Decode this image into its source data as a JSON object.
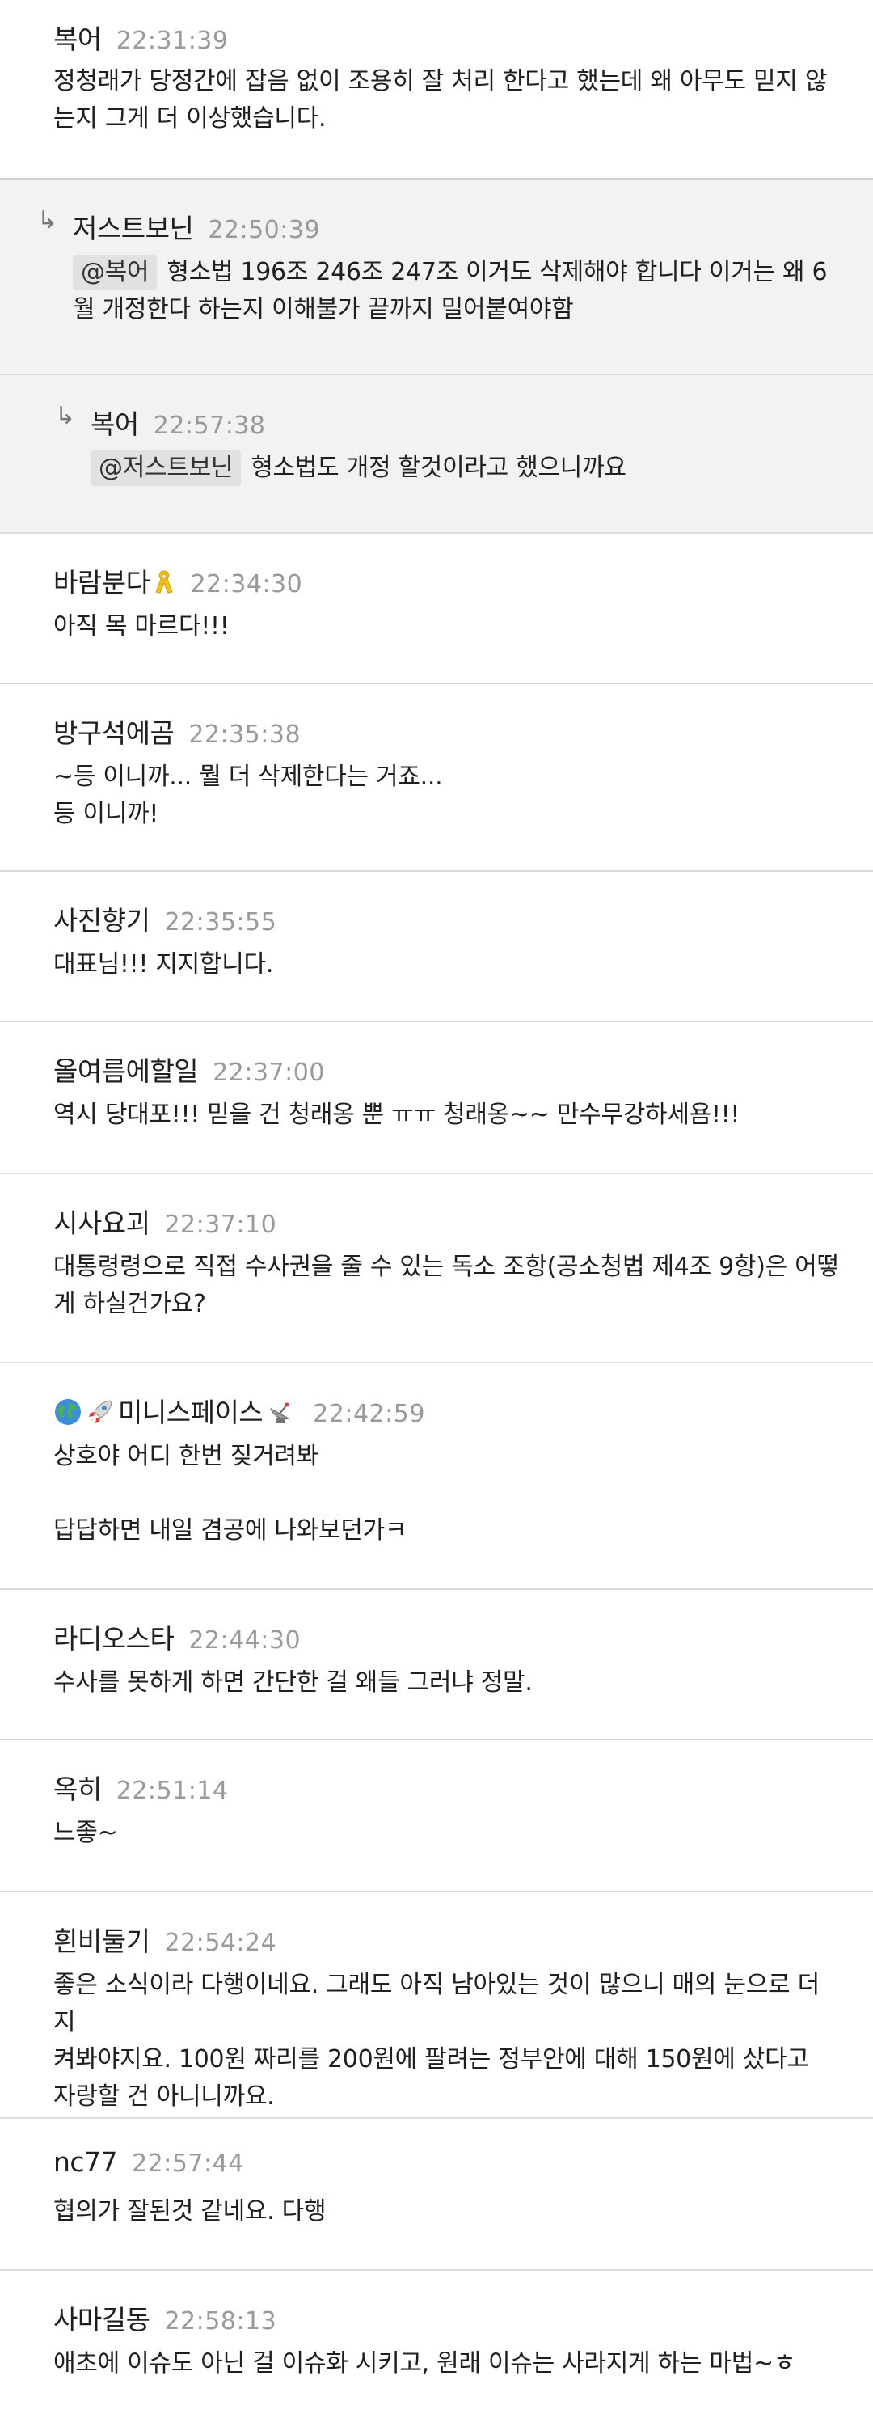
{
  "comments": [
    {
      "author": "복어",
      "time": "22:31:39",
      "lines": [
        "정청래가 당정간에 잡음 없이 조용히 잘 처리 한다고 했는데 왜 아무도 믿지 않",
        "는지 그게 더 이상했습니다."
      ]
    },
    {
      "author": "저스트보닌",
      "time": "22:50:39",
      "mention": "@복어",
      "lines": [
        "형소법 196조 246조 247조 이거도 삭제해야 합니다 이거는 왜 6",
        "월 개정한다 하는지 이해불가 끝까지 밀어붙여야함"
      ]
    },
    {
      "author": "복어",
      "time": "22:57:38",
      "mention": "@저스트보닌",
      "lines": [
        "형소법도 개정 할것이라고 했으니까요"
      ]
    },
    {
      "author": "바람분다",
      "time": "22:34:30",
      "lines": [
        "아직 목 마르다!!!"
      ]
    },
    {
      "author": "방구석에곰",
      "time": "22:35:38",
      "lines": [
        "~등 이니까... 뭘 더 삭제한다는 거죠...",
        "등 이니까!"
      ]
    },
    {
      "author": "사진향기",
      "time": "22:35:55",
      "lines": [
        "대표님!!! 지지합니다."
      ]
    },
    {
      "author": "올여름에할일",
      "time": "22:37:00",
      "lines": [
        "역시 당대포!!! 믿을 건 청래옹 뿐 ㅠㅠ 청래옹~~ 만수무강하세욤!!!"
      ]
    },
    {
      "author": "시사요괴",
      "time": "22:37:10",
      "lines": [
        "대통령령으로 직접 수사권을 줄 수 있는 독소 조항(공소청법 제4조 9항)은 어떻",
        "게 하실건가요?"
      ]
    },
    {
      "author": "미니스페이스",
      "time": "22:42:59",
      "lines": [
        "상호야 어디 한번 짖거려봐",
        "",
        "답답하면 내일 겸공에 나와보던가ㅋ"
      ]
    },
    {
      "author": "라디오스타",
      "time": "22:44:30",
      "lines": [
        "수사를 못하게 하면 간단한 걸 왜들 그러냐 정말."
      ]
    },
    {
      "author": "옥히",
      "time": "22:51:14",
      "lines": [
        "느좋~"
      ]
    },
    {
      "author": "흰비둘기",
      "time": "22:54:24",
      "lines": [
        "좋은 소식이라 다행이네요. 그래도 아직 남아있는 것이 많으니 매의 눈으로 더 지",
        "켜봐야지요. 100원 짜리를 200원에 팔려는 정부안에 대해 150원에 샀다고",
        "자랑할 건 아니니까요."
      ]
    },
    {
      "author": "nc77",
      "time": "22:57:44",
      "lines": [
        "협의가 잘된것 같네요. 다행"
      ]
    },
    {
      "author": "사마길동",
      "time": "22:58:13",
      "lines": [
        "애초에 이슈도 아닌 걸 이슈화 시키고, 원래 이슈는 사라지게 하는 마법~ㅎ"
      ]
    }
  ],
  "icons": {
    "reply": "reply-arrow-icon",
    "ribbon": "yellow-ribbon-icon",
    "globe": "globe-icon",
    "rocket": "rocket-icon",
    "satellite": "satellite-antenna-icon",
    "reply_glyph": "↳"
  },
  "colors": {
    "reply_background": "#f2f2f2",
    "timestamp": "#9a9a9a",
    "mention_background": "#e1e1e1",
    "divider": "#dcdcdc"
  }
}
